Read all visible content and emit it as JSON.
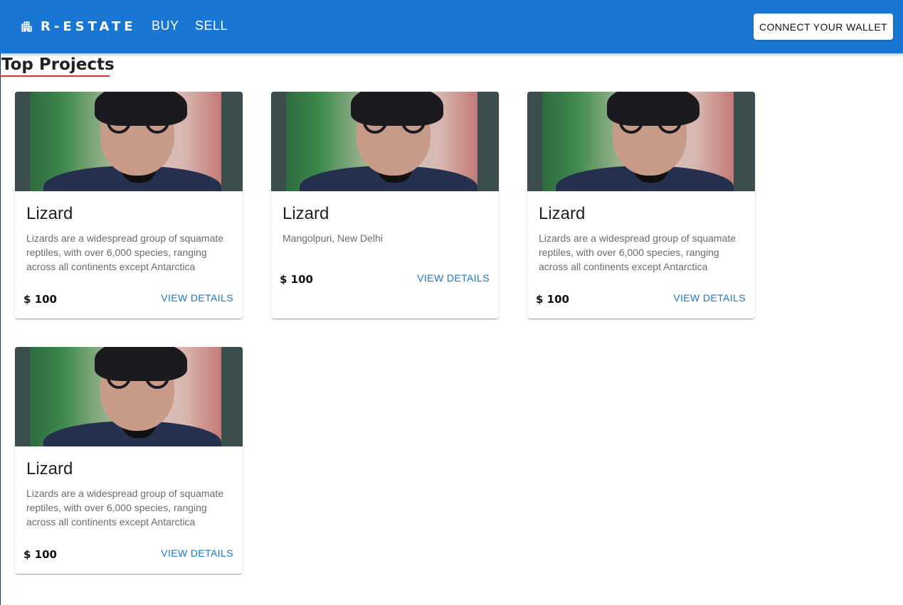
{
  "header": {
    "brand": "R-ESTATE",
    "nav": [
      {
        "label": "BUY"
      },
      {
        "label": "SELL"
      }
    ],
    "wallet_button": "CONNECT YOUR WALLET"
  },
  "section": {
    "title": "Top Projects"
  },
  "cards": [
    {
      "title": "Lizard",
      "description": "Lizards are a widespread group of squamate reptiles, with over 6,000 species, ranging across all continents except Antarctica",
      "price": "$ 100",
      "action": "VIEW DETAILS"
    },
    {
      "title": "Lizard",
      "description": "Mangolpuri, New Delhi",
      "price": "$ 100",
      "action": "VIEW DETAILS"
    },
    {
      "title": "Lizard",
      "description": "Lizards are a widespread group of squamate reptiles, with over 6,000 species, ranging across all continents except Antarctica",
      "price": "$ 100",
      "action": "VIEW DETAILS"
    },
    {
      "title": "Lizard",
      "description": "Lizards are a widespread group of squamate reptiles, with over 6,000 species, ranging across all continents except Antarctica",
      "price": "$ 100",
      "action": "VIEW DETAILS"
    }
  ],
  "colors": {
    "appbar": "#1976d2",
    "accent_underline": "#d32f2f",
    "link": "#1976d2"
  },
  "icons": {
    "brand": "apartment-icon"
  }
}
